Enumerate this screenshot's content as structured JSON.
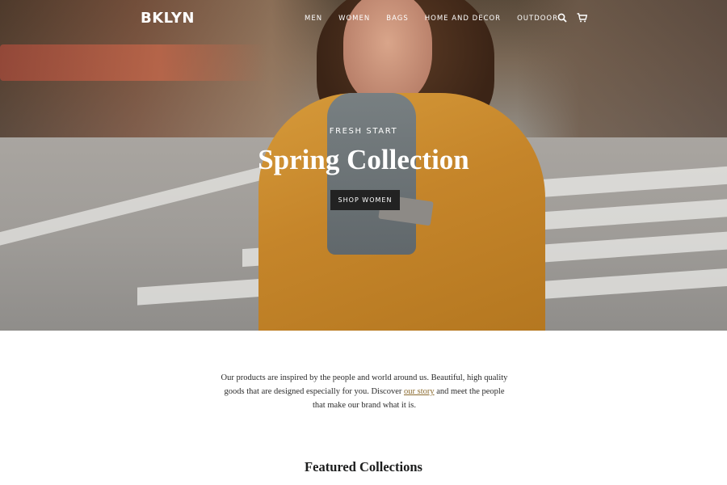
{
  "brand": {
    "logo_text": "BKLYN"
  },
  "nav": {
    "items": [
      {
        "label": "MEN"
      },
      {
        "label": "WOMEN"
      },
      {
        "label": "BAGS"
      },
      {
        "label": "HOME AND DECOR"
      },
      {
        "label": "OUTDOOR"
      }
    ],
    "icons": [
      "search-icon",
      "cart-icon"
    ]
  },
  "hero": {
    "eyebrow": "FRESH START",
    "title": "Spring Collection",
    "button_label": "SHOP WOMEN"
  },
  "intro": {
    "text_before": "Our products are inspired by the people and world around us. Beautiful, high quality goods that are designed especially for you. Discover ",
    "link_text": "our story",
    "text_after": " and meet the people that make our brand what it is."
  },
  "section": {
    "title": "Featured Collections"
  },
  "colors": {
    "accent_link": "#8a6a2e",
    "button_bg": "#222222",
    "text": "#1c1d1d"
  }
}
